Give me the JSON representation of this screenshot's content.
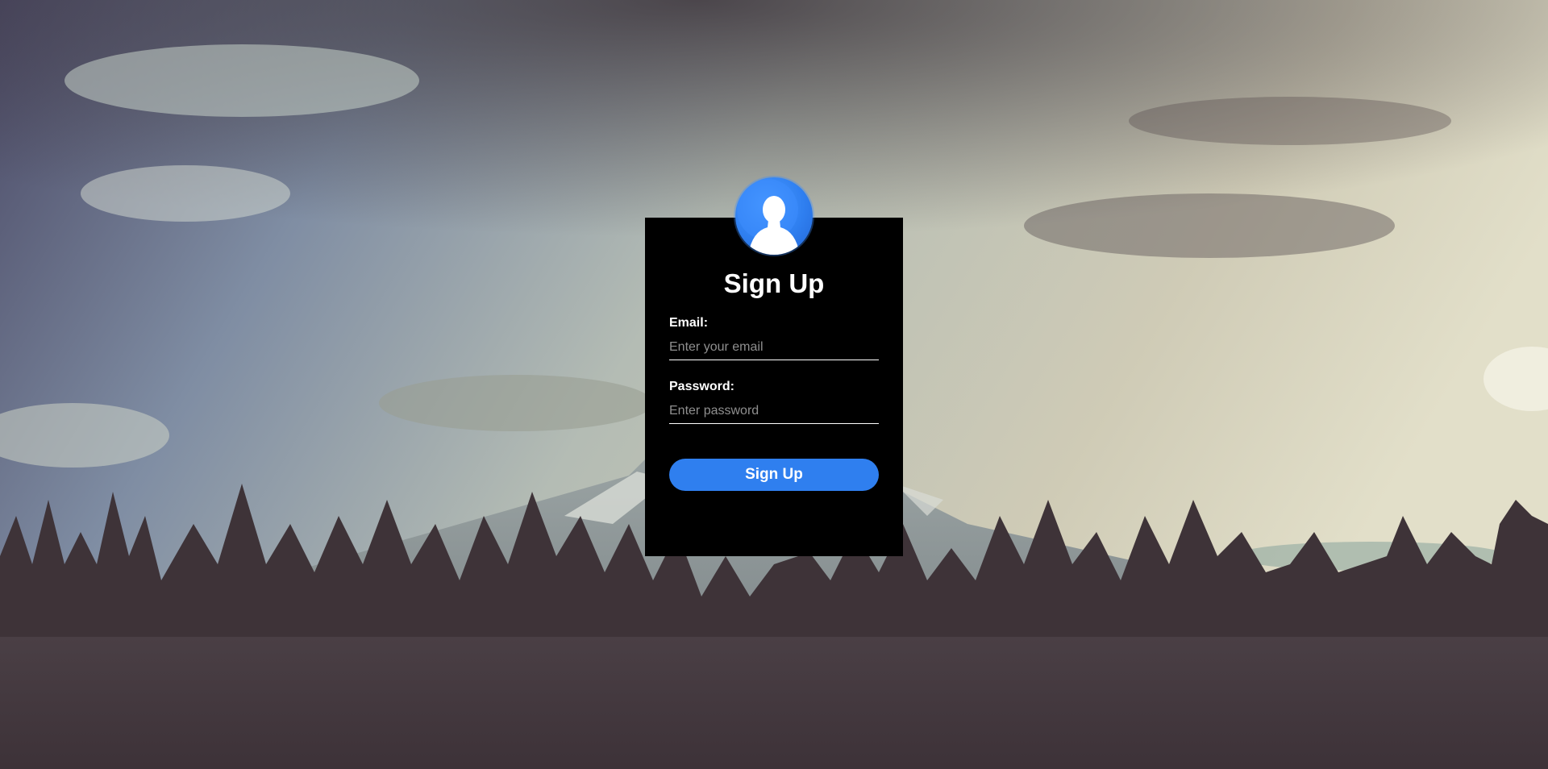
{
  "form": {
    "title": "Sign Up",
    "email_label": "Email:",
    "email_placeholder": "Enter your email",
    "email_value": "",
    "password_label": "Password:",
    "password_placeholder": "Enter password",
    "password_value": "",
    "submit_label": "Sign Up"
  },
  "icons": {
    "avatar": "user-avatar-icon"
  },
  "colors": {
    "card_background": "#000000",
    "button": "#2f7fef",
    "avatar": "#2f7ff0",
    "text": "#ffffff"
  }
}
